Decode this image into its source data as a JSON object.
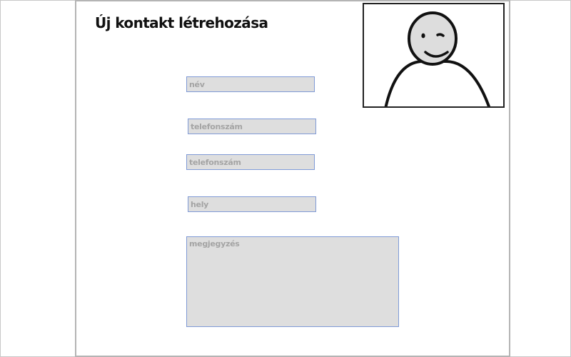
{
  "form": {
    "title": "Új kontakt létrehozása",
    "fields": {
      "name_placeholder": "név",
      "phone1_placeholder": "telefonszám",
      "phone2_placeholder": "telefonszám",
      "place_placeholder": "hely",
      "notes_placeholder": "megjegyzés"
    }
  },
  "avatar": {
    "icon": "person-placeholder-icon",
    "face_color": "#dddddd",
    "stroke_color": "#111111"
  },
  "colors": {
    "field_background": "#dedede",
    "field_border": "#7f9ad6",
    "placeholder_text": "#a4a4a4"
  }
}
